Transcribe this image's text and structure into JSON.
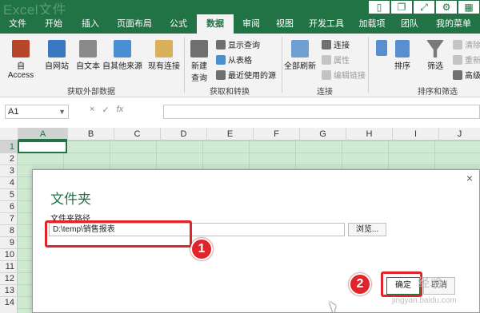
{
  "window": {
    "title": "Excel文件",
    "icons": [
      "phone-icon",
      "copy-icon",
      "expand-icon",
      "settings-icon",
      "grid-icon"
    ]
  },
  "tabs": [
    {
      "label": "文件"
    },
    {
      "label": "开始"
    },
    {
      "label": "插入"
    },
    {
      "label": "页面布局"
    },
    {
      "label": "公式"
    },
    {
      "label": "数据",
      "active": true
    },
    {
      "label": "审阅"
    },
    {
      "label": "视图"
    },
    {
      "label": "开发工具"
    },
    {
      "label": "加载项"
    },
    {
      "label": "团队"
    },
    {
      "label": "我的菜单"
    }
  ],
  "ribbon": {
    "external": {
      "access": "自 Access",
      "web": "自网站",
      "text": "自文本",
      "other": "自其他来源",
      "existing": "现有连接",
      "group": "获取外部数据"
    },
    "transform": {
      "new_query": "新建",
      "new_query2": "查询",
      "show_queries": "显示查询",
      "from_table": "从表格",
      "recent": "最近使用的源",
      "group": "获取和转换"
    },
    "connections": {
      "refresh": "全部刷新",
      "connections": "连接",
      "properties": "属性",
      "edit_links": "编辑链接",
      "group": "连接"
    },
    "sort": {
      "sort": "排序",
      "filter": "筛选",
      "clear": "清除",
      "reapply": "重新应用",
      "advanced": "高级",
      "group": "排序和筛选"
    }
  },
  "formula_bar": {
    "name_box": "A1",
    "cancel": "×",
    "confirm": "✓",
    "fx": "fx"
  },
  "grid": {
    "columns": [
      "A",
      "B",
      "C",
      "D",
      "E",
      "F",
      "G",
      "H",
      "I",
      "J"
    ],
    "rows": [
      "1",
      "2",
      "3",
      "4",
      "5",
      "6",
      "7",
      "8",
      "9",
      "10",
      "11",
      "12",
      "13",
      "14"
    ]
  },
  "dialog": {
    "title": "文件夹",
    "label": "文件夹路径",
    "path_value": "D:\\temp\\销售报表",
    "browse": "浏览...",
    "ok": "确定",
    "cancel": "取消",
    "close": "×"
  },
  "annotations": {
    "badge1": "1",
    "badge2": "2",
    "accent": "#e0242c"
  },
  "watermark": {
    "text": "经验",
    "sub": "jingyan.baidu.com"
  },
  "colors": {
    "excel_green": "#217346",
    "grid_selection": "#cfe9d3"
  }
}
